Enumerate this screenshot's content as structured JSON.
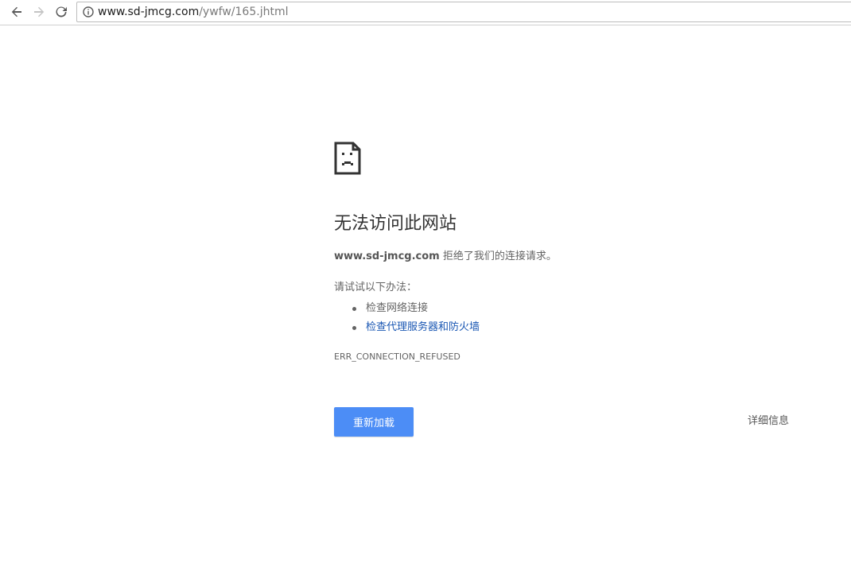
{
  "browser": {
    "url_host": "www.sd-jmcg.com",
    "url_path": "/ywfw/165.jhtml",
    "icons": {
      "back": "back-arrow-icon",
      "forward": "forward-arrow-icon",
      "reload": "reload-icon",
      "info": "info-icon"
    }
  },
  "error_page": {
    "icon": "sad-page-icon",
    "title": "无法访问此网站",
    "host": "www.sd-jmcg.com",
    "description_suffix": " 拒绝了我们的连接请求。",
    "try_label": "请试试以下办法：",
    "suggestions": [
      {
        "label": "检查网络连接",
        "is_link": false
      },
      {
        "label": "检查代理服务器和防火墙",
        "is_link": true
      }
    ],
    "error_code": "ERR_CONNECTION_REFUSED",
    "reload_label": "重新加载",
    "details_label": "详细信息",
    "colors": {
      "primary_button": "#4c8df6",
      "link": "#1a57b3",
      "text": "#646464",
      "title": "#333333"
    }
  }
}
